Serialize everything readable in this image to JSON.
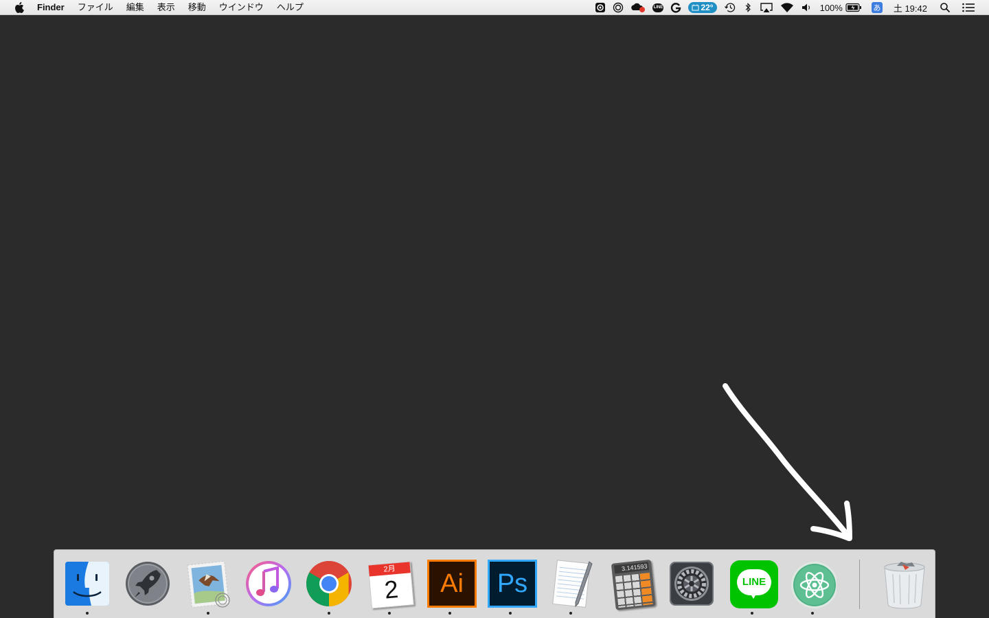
{
  "menubar": {
    "app_name": "Finder",
    "menus": [
      "ファイル",
      "編集",
      "表示",
      "移動",
      "ウインドウ",
      "ヘルプ"
    ],
    "status": {
      "weather_temp": "22°",
      "line_badge": "LINE",
      "battery_percent": "100%",
      "input_method": "あ",
      "clock": "土 19:42"
    }
  },
  "dock": {
    "apps": [
      {
        "name": "Finder",
        "running": true
      },
      {
        "name": "Launchpad",
        "running": false
      },
      {
        "name": "Mail",
        "running": true
      },
      {
        "name": "iTunes",
        "running": false
      },
      {
        "name": "Google Chrome",
        "running": true
      },
      {
        "name": "Calendar",
        "running": true,
        "month": "2月",
        "day": "2"
      },
      {
        "name": "Adobe Illustrator",
        "running": true,
        "label": "Ai"
      },
      {
        "name": "Adobe Photoshop",
        "running": true,
        "label": "Ps"
      },
      {
        "name": "TextEdit",
        "running": true
      },
      {
        "name": "Calculator",
        "running": false,
        "display": "3.141593"
      },
      {
        "name": "System Preferences",
        "running": false
      },
      {
        "name": "LINE",
        "running": true,
        "label": "LINE"
      },
      {
        "name": "Atom",
        "running": true
      }
    ],
    "trash": {
      "name": "Trash",
      "running": false
    }
  },
  "colors": {
    "desktop": "#2b2b2b",
    "weather_badge": "#1f8fc4",
    "ime_badge": "#3d7de0",
    "illustrator_orange": "#ff7c00",
    "photoshop_blue": "#31a8ff",
    "line_green": "#00c300",
    "atom_green": "#4fb185"
  }
}
